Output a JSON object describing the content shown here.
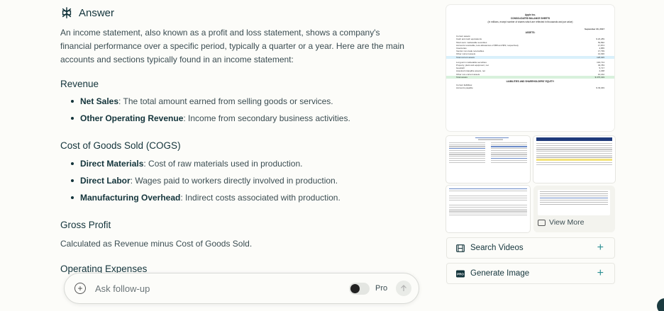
{
  "answer": {
    "title": "Answer",
    "intro": "An income statement, also known as a profit and loss statement, shows a company's financial performance over a specific period, typically a quarter or a year. Here are the main accounts and sections typically found in an income statement:",
    "sections": [
      {
        "heading": "Revenue",
        "items": [
          {
            "term": "Net Sales",
            "desc": ": The total amount earned from selling goods or services."
          },
          {
            "term": "Other Operating Revenue",
            "desc": ": Income from secondary business activities."
          }
        ]
      },
      {
        "heading": "Cost of Goods Sold (COGS)",
        "items": [
          {
            "term": "Direct Materials",
            "desc": ": Cost of raw materials used in production."
          },
          {
            "term": "Direct Labor",
            "desc": ": Wages paid to workers directly involved in production."
          },
          {
            "term": "Manufacturing Overhead",
            "desc": ": Indirect costs associated with production."
          }
        ]
      },
      {
        "heading": "Gross Profit",
        "paragraph": "Calculated as Revenue minus Cost of Goods Sold."
      }
    ],
    "truncated_heading": "Operating Expenses"
  },
  "followup": {
    "placeholder": "Ask follow-up",
    "pro_label": "Pro",
    "pro_enabled": false
  },
  "sources": {
    "doc_preview": {
      "company": "Apple Inc.",
      "title": "CONSOLIDATED BALANCE SHEETS",
      "subtitle": "(In millions, except number of shares which are reflected in thousands and par value)",
      "col_header": "September 30, 2017",
      "assets_label": "ASSETS:",
      "current_assets_label": "Current assets:",
      "rows": [
        {
          "label": "Cash and cash equivalents",
          "value": "$ 20,289"
        },
        {
          "label": "Short-term marketable securities",
          "value": "53,892"
        },
        {
          "label": "Accounts receivable, less allowances of $58 and $53, respectively",
          "value": "17,874"
        },
        {
          "label": "Inventories",
          "value": "4,855"
        },
        {
          "label": "Vendor non-trade receivables",
          "value": "17,799"
        },
        {
          "label": "Other current assets",
          "value": "13,936"
        },
        {
          "label": "Total current assets",
          "value": "128,645",
          "hl": "blue"
        },
        {
          "label": "Long-term marketable securities",
          "value": "194,714"
        },
        {
          "label": "Property, plant and equipment, net",
          "value": "33,783"
        },
        {
          "label": "Goodwill",
          "value": "5,717"
        },
        {
          "label": "Acquired intangible assets, net",
          "value": "2,298"
        },
        {
          "label": "Other non-current assets",
          "value": "10,162"
        },
        {
          "label": "Total assets",
          "value": "$ 375,319",
          "hl": "green"
        }
      ],
      "liabilities_label": "LIABILITIES AND SHAREHOLDERS' EQUITY:",
      "current_liabilities_label": "Current liabilities:",
      "last_row": {
        "label": "Accounts payable",
        "value": "$ 49,049"
      }
    },
    "view_more_label": "View More"
  },
  "actions": [
    {
      "label": "Search Videos",
      "icon": "film-icon"
    },
    {
      "label": "Generate Image",
      "icon": "pro-badge-icon"
    }
  ],
  "colors": {
    "accent": "#2c8f93",
    "text": "#13343b",
    "background": "#fcfcf9"
  }
}
